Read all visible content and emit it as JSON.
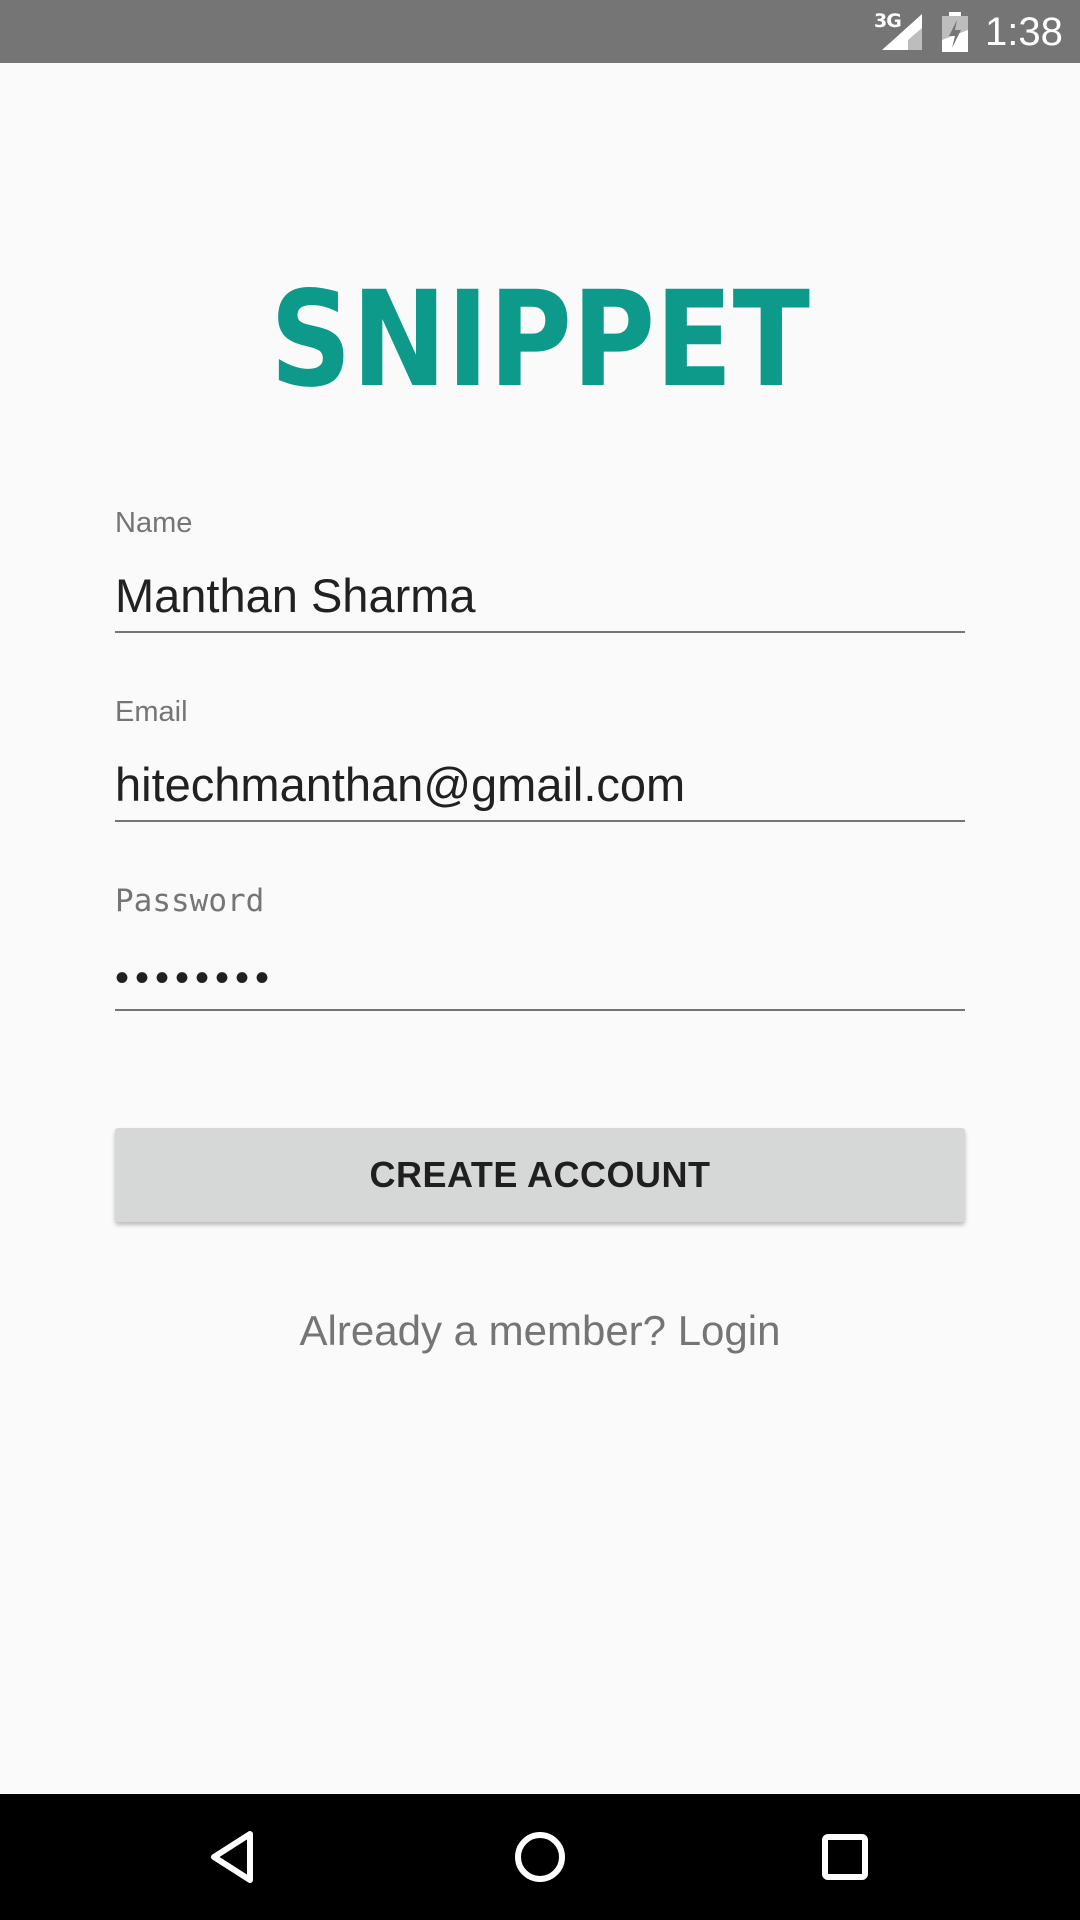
{
  "status_bar": {
    "network": "3G",
    "time": "1:38",
    "icons": [
      "signal-icon",
      "battery-icon"
    ]
  },
  "logo": {
    "text": "SNIPPET",
    "color": "#0e9a8b"
  },
  "form": {
    "name": {
      "label": "Name",
      "value": "Manthan Sharma"
    },
    "email": {
      "label": "Email",
      "value": "hitechmanthan@gmail.com"
    },
    "password": {
      "label": "Password",
      "value": "••••••••"
    }
  },
  "create_button": {
    "label": "CREATE ACCOUNT"
  },
  "login_link": {
    "label": "Already a member? Login"
  },
  "nav_bar": {
    "icons": [
      "back-icon",
      "home-icon",
      "recents-icon"
    ]
  }
}
